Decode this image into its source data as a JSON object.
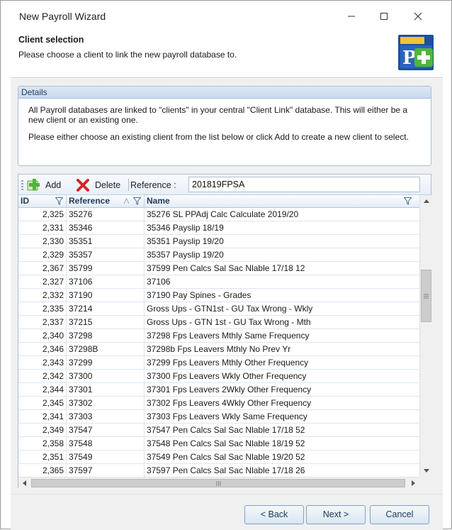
{
  "window": {
    "title": "New Payroll Wizard"
  },
  "header": {
    "title": "Client selection",
    "subtitle": "Please choose a client to link the new payroll database to.",
    "logo_icon": "payroll-add-icon"
  },
  "details": {
    "heading": "Details",
    "para1": "All Payroll databases are linked to \"clients\" in your central \"Client Link\" database. This will either be a new client or an existing one.",
    "para2": "Please either choose an existing client from the list below or click Add to create a new client to select."
  },
  "toolbar": {
    "add_label": "Add",
    "delete_label": "Delete",
    "reference_label": "Reference :",
    "reference_value": "201819FPSA"
  },
  "columns": {
    "id": "ID",
    "reference": "Reference",
    "name": "Name"
  },
  "rows": [
    {
      "id": "2,325",
      "reference": "35276",
      "name": "35276 SL PPAdj Calc Calculate 2019/20"
    },
    {
      "id": "2,331",
      "reference": "35346",
      "name": "35346 Payslip 18/19"
    },
    {
      "id": "2,330",
      "reference": "35351",
      "name": "35351 Payslip 19/20"
    },
    {
      "id": "2,329",
      "reference": "35357",
      "name": "35357 Payslip 19/20"
    },
    {
      "id": "2,367",
      "reference": "35799",
      "name": "37599 Pen Calcs Sal Sac Nlable 17/18 12"
    },
    {
      "id": "2,327",
      "reference": "37106",
      "name": "37106"
    },
    {
      "id": "2,332",
      "reference": "37190",
      "name": "37190 Pay Spines - Grades"
    },
    {
      "id": "2,335",
      "reference": "37214",
      "name": "Gross Ups - GTN1st - GU Tax Wrong - Wkly"
    },
    {
      "id": "2,337",
      "reference": "37215",
      "name": "Gross Ups - GTN 1st - GU Tax Wrong - Mth"
    },
    {
      "id": "2,340",
      "reference": "37298",
      "name": "37298 Fps Leavers Mthly Same Frequency"
    },
    {
      "id": "2,346",
      "reference": "37298B",
      "name": "37298b Fps Leavers Mthly No Prev Yr"
    },
    {
      "id": "2,343",
      "reference": "37299",
      "name": "37299 Fps Leavers Mthly Other Frequency"
    },
    {
      "id": "2,342",
      "reference": "37300",
      "name": "37300 Fps Leavers Wkly Other Frequency"
    },
    {
      "id": "2,344",
      "reference": "37301",
      "name": "37301 Fps Leavers 2Wkly Other Frequency"
    },
    {
      "id": "2,345",
      "reference": "37302",
      "name": "37302 Fps Leavers 4Wkly Other Frequency"
    },
    {
      "id": "2,341",
      "reference": "37303",
      "name": "37303 Fps Leavers Wkly Same Frequency"
    },
    {
      "id": "2,349",
      "reference": "37547",
      "name": "37547 Pen Calcs Sal Sac Nlable 17/18 52"
    },
    {
      "id": "2,358",
      "reference": "37548",
      "name": "37548 Pen Calcs Sal Sac Nlable 18/19 52"
    },
    {
      "id": "2,351",
      "reference": "37549",
      "name": "37549 Pen Calcs Sal Sac Nlable 19/20 52"
    },
    {
      "id": "2,365",
      "reference": "37597",
      "name": "37597 Pen Calcs Sal Sac Nlable 17/18 26"
    }
  ],
  "buttons": {
    "back": "< Back",
    "next": "Next >",
    "cancel": "Cancel"
  }
}
